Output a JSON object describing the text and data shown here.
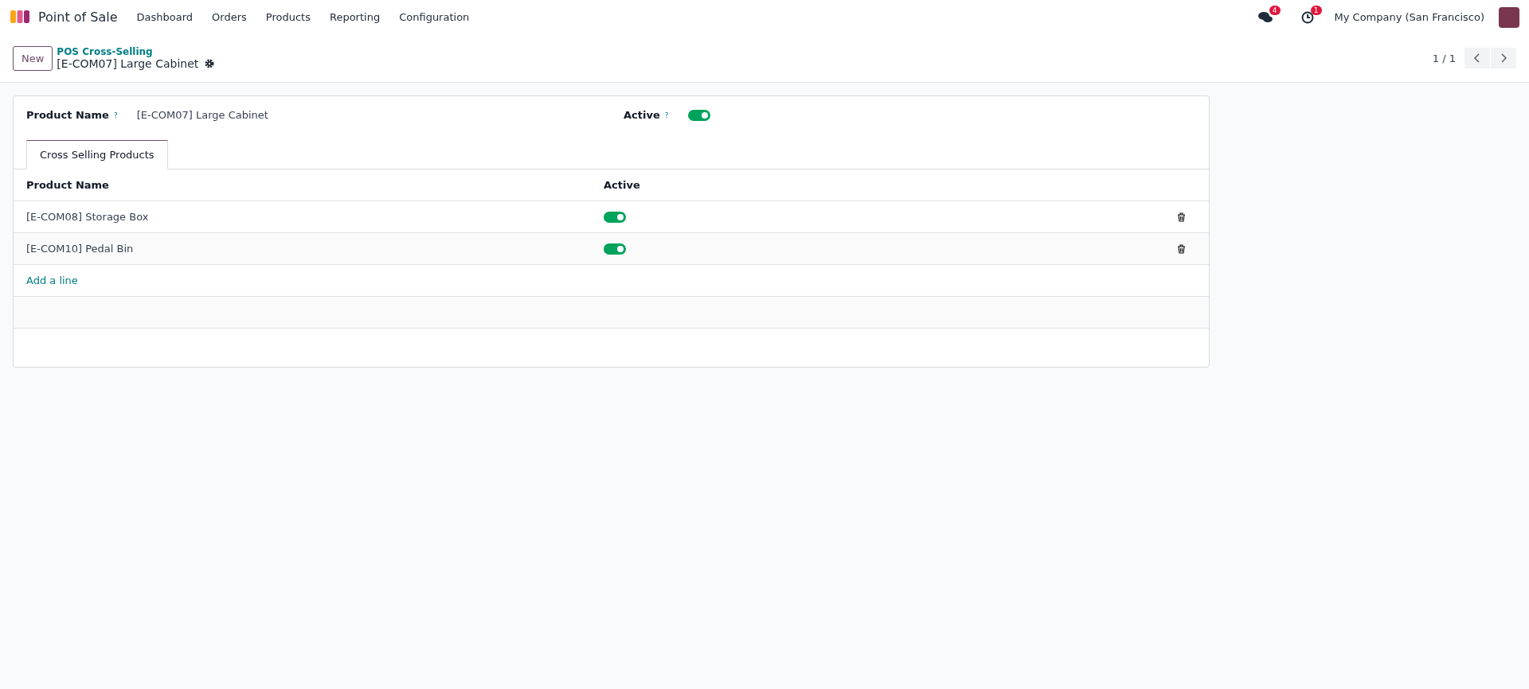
{
  "navbar": {
    "app_name": "Point of Sale",
    "menu": [
      "Dashboard",
      "Orders",
      "Products",
      "Reporting",
      "Configuration"
    ],
    "messages_count": "4",
    "activities_count": "1",
    "company": "My Company (San Francisco)"
  },
  "control_panel": {
    "new_button": "New",
    "breadcrumb": "POS Cross-Selling",
    "record_title": "[E-COM07] Large Cabinet",
    "pager": "1 / 1"
  },
  "form": {
    "product_label": "Product Name",
    "product_help": "?",
    "product_value": "[E-COM07] Large Cabinet",
    "active_label": "Active",
    "active_help": "?",
    "active": true
  },
  "tabs": [
    {
      "label": "Cross Selling Products",
      "selected": true
    }
  ],
  "table": {
    "columns": [
      "Product Name",
      "Active"
    ],
    "rows": [
      {
        "product": "[E-COM08] Storage Box",
        "active": true
      },
      {
        "product": "[E-COM10] Pedal Bin",
        "active": true
      }
    ],
    "add_line": "Add a line"
  }
}
